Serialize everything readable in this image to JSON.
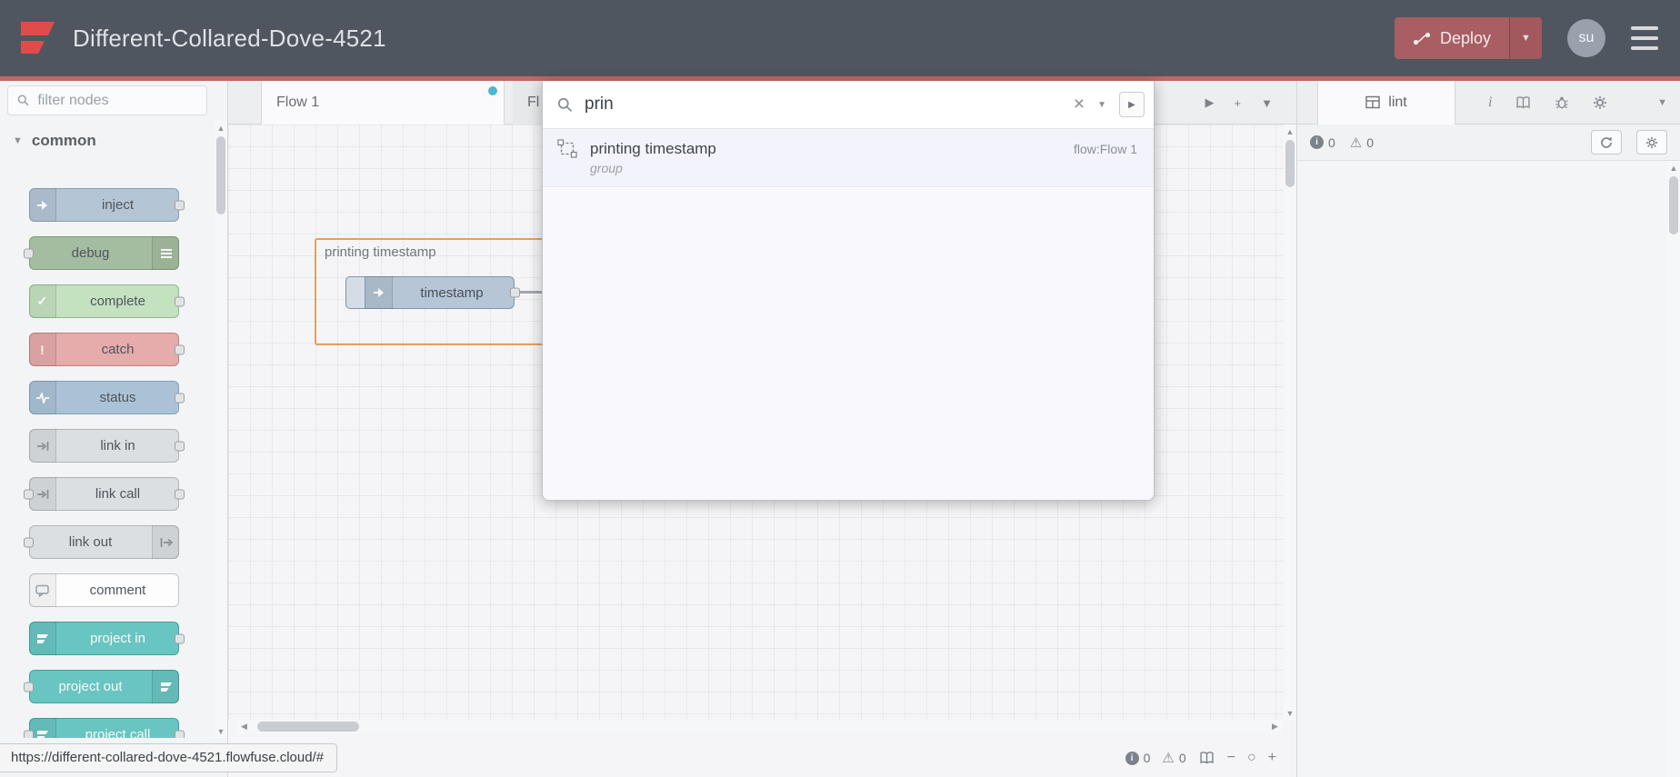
{
  "header": {
    "title": "Different-Collared-Dove-4521",
    "deploy": {
      "label": "Deploy"
    },
    "avatar": "su"
  },
  "palette": {
    "filter_placeholder": "filter nodes",
    "category_label": "common",
    "nodes": [
      {
        "label": "inject",
        "color": "#b4c5d6"
      },
      {
        "label": "debug",
        "color": "#a4bda0"
      },
      {
        "label": "complete",
        "color": "#c4e2c0"
      },
      {
        "label": "catch",
        "color": "#e6abab"
      },
      {
        "label": "status",
        "color": "#abc2d6"
      },
      {
        "label": "link in",
        "color": "#dcdfe2"
      },
      {
        "label": "link call",
        "color": "#dcdfe2"
      },
      {
        "label": "link out",
        "color": "#dcdfe2"
      },
      {
        "label": "comment",
        "color": "#fdfdfe"
      },
      {
        "label": "project in",
        "color": "#69c5c1"
      },
      {
        "label": "project out",
        "color": "#69c5c1"
      },
      {
        "label": "project call",
        "color": "#69c5c1"
      }
    ]
  },
  "workspace": {
    "tabs": [
      {
        "label": "Flow 1",
        "active": true
      },
      {
        "label": "Fl",
        "active": false
      }
    ],
    "group_label": "printing timestamp",
    "node_label": "timestamp"
  },
  "search": {
    "query": "prin",
    "result": {
      "title": "printing timestamp",
      "subtitle": "group",
      "meta": "flow:Flow 1"
    }
  },
  "sidebar": {
    "tab_label": "lint",
    "info_count": "0",
    "warning_count": "0"
  },
  "footer": {
    "info_count": "0",
    "warning_count": "0"
  },
  "status_tooltip": "https://different-collared-dove-4521.flowfuse.cloud/#",
  "colors": {
    "header_bg": "#50565f",
    "accent_red": "#c26764",
    "deploy_bg": "#a85e62",
    "tab_dot": "#4db7d0",
    "group_selection_border": "#dfa263"
  }
}
